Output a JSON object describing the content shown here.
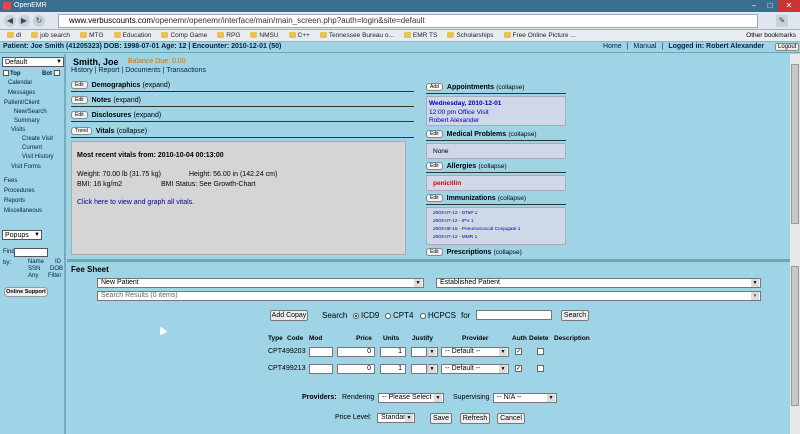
{
  "browser": {
    "tab_title": "OpenEMR",
    "url_host": "www.verbuscounts.com",
    "url_path": "/openemr/openemr/interface/main/main_screen.php?auth=login&site=default",
    "other_bookmarks": "Other bookmarks",
    "bookmarks": [
      "dl",
      "job search",
      "MTG",
      "Education",
      "Comp Game",
      "RPG",
      "NMSU",
      "C++",
      "Tennessee Bureau o...",
      "EMR TS",
      "Scholarships",
      "Free Online Picture ..."
    ]
  },
  "header": {
    "patient_line": "Patient: Joe Smith (41205323)  DOB: 1998-07-01 Age: 12  |  Encounter: 2010-12-01 (50)",
    "home": "Home",
    "manual": "Manual",
    "logged_in": "Logged in: Robert Alexander",
    "logout": "Logout"
  },
  "nav": {
    "view_select": "Default",
    "top": "Top",
    "bot": "Bot",
    "items": [
      "Calendar",
      "Messages",
      "Patient/Client",
      "New/Search",
      "Summary",
      "Visits",
      "Create Visit",
      "Current",
      "Visit History",
      "Visit Forms",
      "Fees",
      "Procedures",
      "Reports",
      "Miscellaneous"
    ],
    "popups": "Popups",
    "find_label": "Find:",
    "by": "by:",
    "find_opts": [
      "Name",
      "ID",
      "SSN",
      "DOB",
      "Any",
      "Filter"
    ],
    "online_support": "Online Support"
  },
  "patient": {
    "name": "Smith, Joe",
    "balance": "Balance Due: 0.00",
    "links": "History | Report | Documents | Transactions"
  },
  "sections": [
    {
      "btn": "Edit",
      "title": "Demographics",
      "toggle": "(expand)"
    },
    {
      "btn": "Edit",
      "title": "Notes",
      "toggle": "(expand)"
    },
    {
      "btn": "Edit",
      "title": "Disclosures",
      "toggle": "(expand)"
    },
    {
      "btn": "Trend",
      "title": "Vitals",
      "toggle": "(collapse)"
    }
  ],
  "vitals": {
    "recent": "Most recent vitals from: 2010-10-04 00:13:00",
    "weight": "Weight: 70.00 lb (31.75 kg)",
    "height": "Height: 56.00 in (142.24 cm)",
    "bmi": "BMI: 16 kg/m2",
    "bmi_status": "BMI Status: See Growth-Chart",
    "link": "Click here to view and graph all vitals."
  },
  "right": {
    "appointments": {
      "btn": "Add",
      "title": "Appointments",
      "toggle": "(collapse)"
    },
    "appt_date": "Wednesday, 2010-12-01",
    "appt_time": "12:00 pm Office Visit",
    "appt_provider": "Robert Alexander",
    "medical": {
      "btn": "Edit",
      "title": "Medical Problems",
      "toggle": "(collapse)"
    },
    "none": "None",
    "allergies": {
      "btn": "Edit",
      "title": "Allergies",
      "toggle": "(collapse)"
    },
    "allergy": "penicillin",
    "immunizations": {
      "btn": "Edit",
      "title": "Immunizations",
      "toggle": "(collapse)"
    },
    "imm_list": [
      "2003-07-12 - DTaP 1",
      "2003-07-12 - IPV 1",
      "2003-08-15 - Pneumococcal Conjugate 1",
      "2003-07-12 - MMR 1"
    ],
    "prescriptions": {
      "btn": "Edit",
      "title": "Prescriptions",
      "toggle": "(collapse)"
    }
  },
  "fee": {
    "title": "Fee Sheet",
    "sel_new": "New Patient",
    "sel_est": "Established Patient",
    "search_results": "Search Results (0 items)",
    "add_copay": "Add Copay",
    "search_label": "Search",
    "icd9": "ICD9",
    "cpt4": "CPT4",
    "hcpcs": "HCPCS",
    "for": "for",
    "search_btn": "Search",
    "cols": [
      "Type",
      "Code",
      "Mod",
      "Price",
      "Units",
      "Justify",
      "Provider",
      "Auth",
      "Delete",
      "Description"
    ],
    "rows": [
      {
        "type": "CPT4",
        "code": "99203",
        "price": "0",
        "units": "1",
        "provider": "-- Default --"
      },
      {
        "type": "CPT4",
        "code": "99213",
        "price": "0",
        "units": "1",
        "provider": "-- Default --"
      }
    ],
    "providers": "Providers:",
    "rendering": "Rendering",
    "rendering_val": "-- Please Select --",
    "supervising": "Supervising",
    "supervising_val": "-- N/A --",
    "price_level": "Price Level:",
    "price_level_val": "Standard",
    "save": "Save",
    "refresh": "Refresh",
    "cancel": "Cancel"
  }
}
